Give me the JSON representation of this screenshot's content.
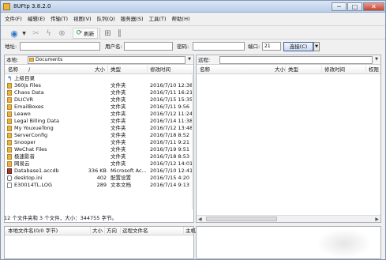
{
  "window": {
    "title": "8UFtp 3.8.2.0",
    "buttons": [
      "─",
      "□",
      "✕"
    ]
  },
  "menu": [
    "文件(F)",
    "编辑(E)",
    "传输(T)",
    "视图(V)",
    "队列(Q)",
    "服务器(S)",
    "工具(T)",
    "帮助(H)"
  ],
  "toolbar": {
    "refresh_label": "刷新",
    "icons": [
      "connect-globe-icon",
      "dropdown-arrow-icon",
      "disconnect-icon",
      "lightning-icon",
      "cancel-icon",
      "refresh-icon",
      "filter-icon",
      "pause-icon"
    ]
  },
  "address_bar": {
    "address_label": "地址:",
    "address_value": "",
    "user_label": "用户名:",
    "user_value": "",
    "password_label": "密码:",
    "password_value": "",
    "port_label": "端口:",
    "port_value": "21",
    "connect_label": "连接(C)"
  },
  "local": {
    "path_label": "本地:",
    "path_value": "Documents",
    "columns": {
      "name": "名称",
      "size": "大小",
      "type": "类型",
      "modified": "修改时间"
    },
    "files": [
      {
        "name": "上级目录",
        "size": "",
        "type": "",
        "modified": "",
        "icon": "up"
      },
      {
        "name": "360js Files",
        "size": "",
        "type": "文件夹",
        "modified": "2016/7/10 12:38",
        "icon": "folder"
      },
      {
        "name": "Chaos Data",
        "size": "",
        "type": "文件夹",
        "modified": "2016/7/11 16:21",
        "icon": "folder"
      },
      {
        "name": "DLICVR",
        "size": "",
        "type": "文件夹",
        "modified": "2016/7/15 15:35",
        "icon": "folder"
      },
      {
        "name": "EmailBoxes",
        "size": "",
        "type": "文件夹",
        "modified": "2016/7/11 9:56",
        "icon": "folder"
      },
      {
        "name": "Leawo",
        "size": "",
        "type": "文件夹",
        "modified": "2016/7/12 11:24",
        "icon": "folder"
      },
      {
        "name": "Legal Billing Data",
        "size": "",
        "type": "文件夹",
        "modified": "2016/7/14 11:38",
        "icon": "folder"
      },
      {
        "name": "My YouxueTong",
        "size": "",
        "type": "文件夹",
        "modified": "2016/7/12 13:48",
        "icon": "folder"
      },
      {
        "name": "ServerConfig",
        "size": "",
        "type": "文件夹",
        "modified": "2016/7/18 8:52",
        "icon": "folder"
      },
      {
        "name": "Snooper",
        "size": "",
        "type": "文件夹",
        "modified": "2016/7/11 9:21",
        "icon": "folder"
      },
      {
        "name": "WeChat Files",
        "size": "",
        "type": "文件夹",
        "modified": "2016/7/19 9:51",
        "icon": "folder"
      },
      {
        "name": "极速影音",
        "size": "",
        "type": "文件夹",
        "modified": "2016/7/18 8:53",
        "icon": "folder"
      },
      {
        "name": "网易云",
        "size": "",
        "type": "文件夹",
        "modified": "2016/7/12 14:01",
        "icon": "folder"
      },
      {
        "name": "Database1.accdb",
        "size": "336 KB",
        "type": "Microsoft Ac...",
        "modified": "2016/7/10 12:41",
        "icon": "db"
      },
      {
        "name": "desktop.ini",
        "size": "402",
        "type": "配置设置",
        "modified": "2016/7/15 4:20",
        "icon": "ini"
      },
      {
        "name": "E30014TL.LOG",
        "size": "289",
        "type": "文本文档",
        "modified": "2016/7/14 9:13",
        "icon": "txt"
      }
    ]
  },
  "remote": {
    "path_label": "远程:",
    "path_value": "",
    "columns": {
      "name": "名称",
      "size": "大小",
      "type": "类型",
      "modified": "修改时间",
      "permissions": "权限"
    }
  },
  "status_text": "12 个文件夹和 3 个文件，大小：344755 字节。",
  "queue": {
    "columns": {
      "local_file": "本地文件名(0/0 字节)",
      "size": "大小",
      "direction": "方向",
      "remote_file": "远程文件名",
      "host": "主机"
    }
  }
}
